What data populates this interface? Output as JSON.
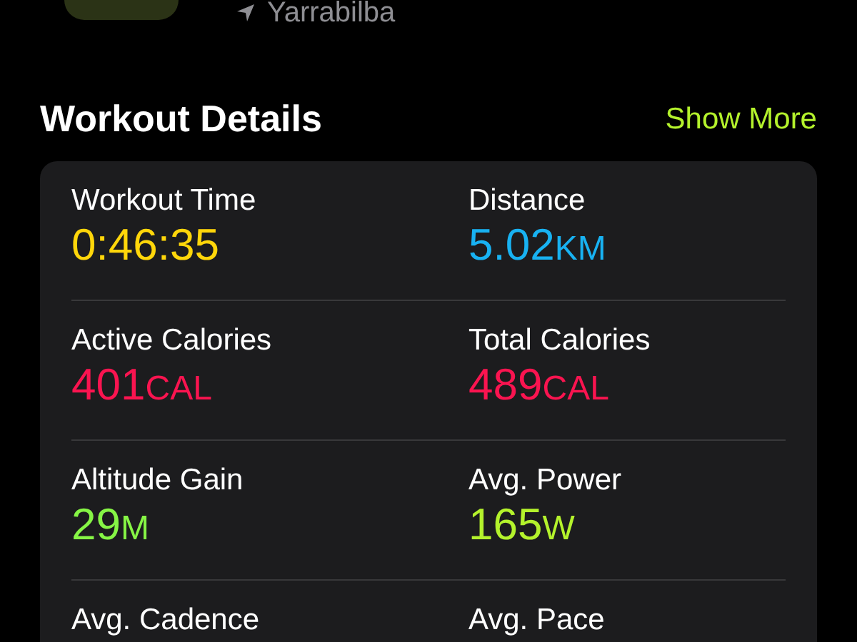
{
  "location": {
    "name": "Yarrabilba"
  },
  "section": {
    "title": "Workout Details",
    "action": "Show More"
  },
  "metrics": [
    {
      "label": "Workout Time",
      "value": "0:46:35",
      "color": "#ffd60a"
    },
    {
      "label": "Distance",
      "value": "5.02",
      "unit": "KM",
      "color": "#18b2f2"
    },
    {
      "label": "Active Calories",
      "value": "401",
      "unit": "CAL",
      "color": "#fa1450"
    },
    {
      "label": "Total Calories",
      "value": "489",
      "unit": "CAL",
      "color": "#fa1450"
    },
    {
      "label": "Altitude Gain",
      "value": "29",
      "unit": "M",
      "color": "#86f545"
    },
    {
      "label": "Avg. Power",
      "value": "165",
      "unit": "W",
      "color": "#b4f22c"
    },
    {
      "label": "Avg. Cadence"
    },
    {
      "label": "Avg. Pace"
    }
  ]
}
